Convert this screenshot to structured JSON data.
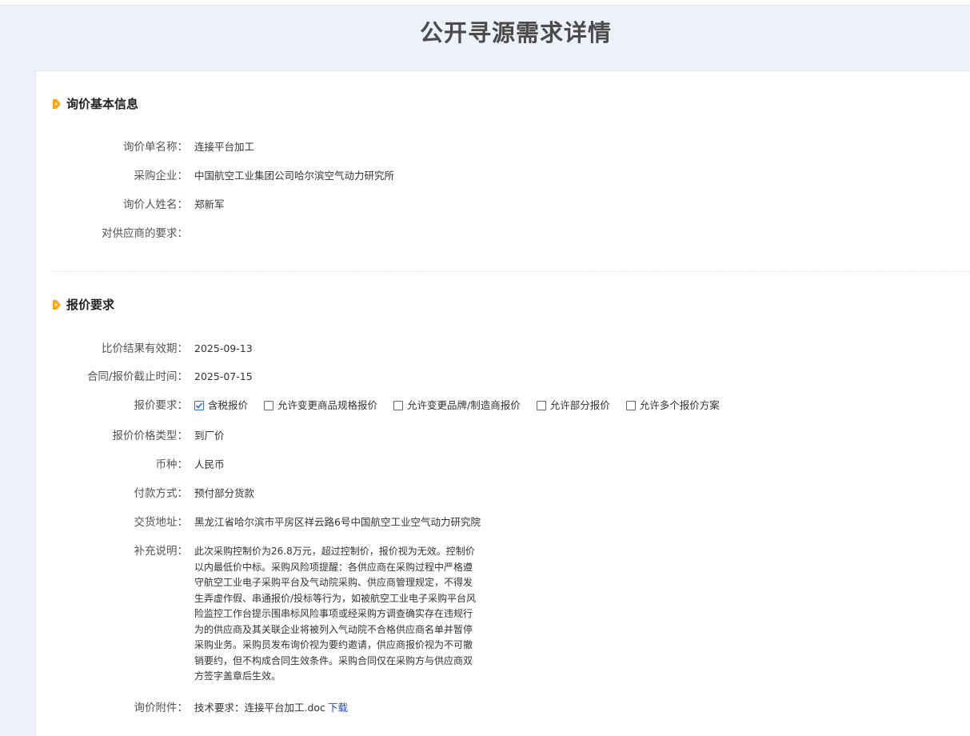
{
  "page": {
    "title": "公开寻源需求详情"
  },
  "basic_info": {
    "heading": "询价基本信息",
    "fields": [
      {
        "label": "询价单名称：",
        "value": "连接平台加工"
      },
      {
        "label": "采购企业：",
        "value": "中国航空工业集团公司哈尔滨空气动力研究所"
      },
      {
        "label": "询价人姓名：",
        "value": "郑新军"
      },
      {
        "label": "对供应商的要求：",
        "value": ""
      }
    ]
  },
  "quote_req": {
    "heading": "报价要求",
    "validity": {
      "label": "比价结果有效期：",
      "value": "2025-09-13"
    },
    "deadline": {
      "label": "合同/报价截止时间：",
      "value": "2025-07-15"
    },
    "requirements": {
      "label": "报价要求：",
      "options": [
        {
          "label": "含税报价",
          "checked": true
        },
        {
          "label": "允许变更商品规格报价",
          "checked": false
        },
        {
          "label": "允许变更品牌/制造商报价",
          "checked": false
        },
        {
          "label": "允许部分报价",
          "checked": false
        },
        {
          "label": "允许多个报价方案",
          "checked": false
        }
      ]
    },
    "price_type": {
      "label": "报价价格类型：",
      "value": "到厂价"
    },
    "currency": {
      "label": "币种：",
      "value": "人民币"
    },
    "payment": {
      "label": "付款方式：",
      "value": "预付部分货款"
    },
    "delivery": {
      "label": "交货地址：",
      "value": "黑龙江省哈尔滨市平房区祥云路6号中国航空工业空气动力研究院"
    },
    "remark": {
      "label": "补充说明：",
      "value": "此次采购控制价为26.8万元，超过控制价，报价视为无效。控制价以内最低价中标。采购风险项提醒：各供应商在采购过程中严格遵守航空工业电子采购平台及气动院采购、供应商管理规定，不得发生弄虚作假、串通报价/投标等行为，如被航空工业电子采购平台风险监控工作台提示围串标风险事项或经采购方调查确实存在违规行为的供应商及其关联企业将被列入气动院不合格供应商名单并暂停采购业务。采购员发布询价视为要约邀请，供应商报价视为不可撤销要约，但不构成合同生效条件。采购合同仅在采购方与供应商双方签字盖章后生效。"
    },
    "attachment": {
      "label": "询价附件：",
      "file": "技术要求：连接平台加工.doc",
      "download": "下载"
    }
  },
  "colors": {
    "accent": "#f5a623",
    "link": "#1a49d8",
    "check": "#3b6dd8"
  }
}
